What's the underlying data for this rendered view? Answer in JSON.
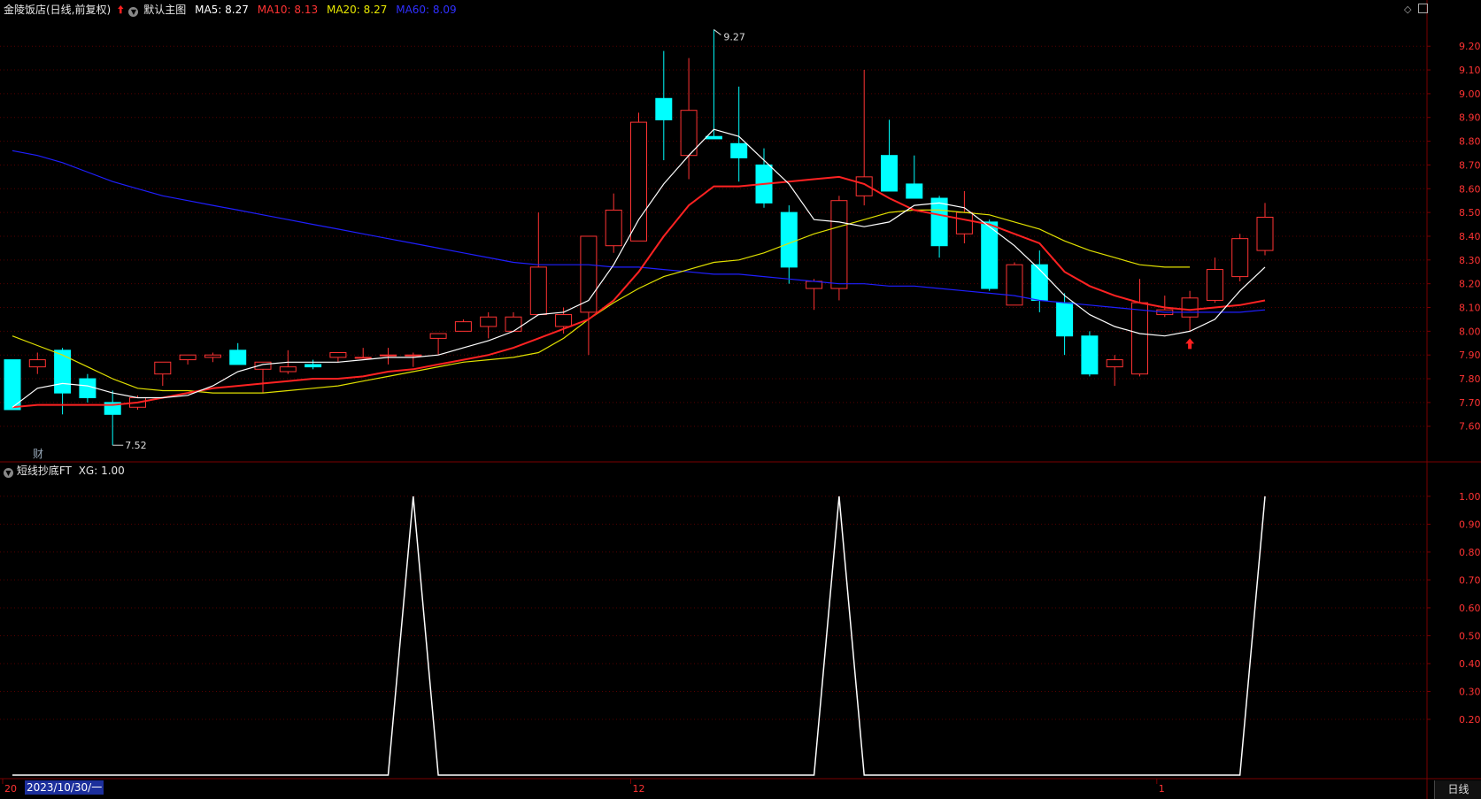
{
  "header": {
    "stock_name": "金陵饭店(日线,前复权)",
    "template_label": "默认主图",
    "ma": [
      {
        "label": "MA5:",
        "value": "8.27",
        "color": "#ffffff"
      },
      {
        "label": "MA10:",
        "value": "8.13",
        "color": "#ff3333"
      },
      {
        "label": "MA20:",
        "value": "8.27",
        "color": "#e8e800"
      },
      {
        "label": "MA60:",
        "value": "8.09",
        "color": "#2a2aff"
      }
    ]
  },
  "sub_header": {
    "indicator_name": "短线抄底FT",
    "xg_label": "XG:",
    "xg_value": "1.00"
  },
  "colors": {
    "up": "#ff3333",
    "down": "#00ffff",
    "grid": "#550000",
    "axis_text": "#ff3333",
    "ma5": "#ffffff",
    "ma10": "#ff2222",
    "ma20": "#e0e000",
    "ma60": "#1f1fff",
    "xg_line": "#ffffff"
  },
  "icons": {
    "up_arrow": "red-up-arrow-icon",
    "toggle": "circle-chevron-icon",
    "fin_marker": "财"
  },
  "price_axis": {
    "min": 7.45,
    "max": 9.32,
    "ticks": [
      "9.20",
      "9.10",
      "9.00",
      "8.90",
      "8.80",
      "8.70",
      "8.60",
      "8.50",
      "8.40",
      "8.30",
      "8.20",
      "8.10",
      "8.00",
      "7.90",
      "7.80",
      "7.70",
      "7.60"
    ]
  },
  "indicator_axis": {
    "min": 0,
    "max": 1.06,
    "ticks": [
      "1.00",
      "0.90",
      "0.80",
      "0.70",
      "0.60",
      "0.50",
      "0.40",
      "0.30",
      "0.20"
    ]
  },
  "annotations": {
    "high": "9.27",
    "low": "7.52",
    "fin_label": "财"
  },
  "x_axis": {
    "labels": [
      "20",
      "12",
      "1"
    ],
    "cursor_date": "2023/10/30/一"
  },
  "period_button": "日线",
  "chart_data": {
    "type": "candlestick",
    "ohlc": [
      [
        7.88,
        7.88,
        7.67,
        7.67
      ],
      [
        7.85,
        7.91,
        7.82,
        7.88
      ],
      [
        7.92,
        7.93,
        7.65,
        7.74
      ],
      [
        7.8,
        7.82,
        7.7,
        7.72
      ],
      [
        7.7,
        7.75,
        7.52,
        7.65
      ],
      [
        7.68,
        7.73,
        7.67,
        7.72
      ],
      [
        7.82,
        7.87,
        7.77,
        7.87
      ],
      [
        7.88,
        7.9,
        7.86,
        7.9
      ],
      [
        7.89,
        7.91,
        7.87,
        7.9
      ],
      [
        7.92,
        7.95,
        7.86,
        7.86
      ],
      [
        7.84,
        7.87,
        7.74,
        7.87
      ],
      [
        7.83,
        7.92,
        7.82,
        7.85
      ],
      [
        7.86,
        7.88,
        7.84,
        7.85
      ],
      [
        7.89,
        7.91,
        7.87,
        7.91
      ],
      [
        7.89,
        7.93,
        7.89,
        7.89
      ],
      [
        7.9,
        7.93,
        7.86,
        7.9
      ],
      [
        7.9,
        7.91,
        7.85,
        7.9
      ],
      [
        7.97,
        7.99,
        7.9,
        7.99
      ],
      [
        8.0,
        8.05,
        8.0,
        8.04
      ],
      [
        8.02,
        8.08,
        7.97,
        8.06
      ],
      [
        8.0,
        8.08,
        8.0,
        8.06
      ],
      [
        8.07,
        8.5,
        8.07,
        8.27
      ],
      [
        8.02,
        8.1,
        7.99,
        8.07
      ],
      [
        8.08,
        8.25,
        7.9,
        8.4
      ],
      [
        8.36,
        8.58,
        8.33,
        8.51
      ],
      [
        8.38,
        8.92,
        8.38,
        8.88
      ],
      [
        8.98,
        9.18,
        8.72,
        8.89
      ],
      [
        8.74,
        9.15,
        8.64,
        8.93
      ],
      [
        8.82,
        9.27,
        8.81,
        8.81
      ],
      [
        8.79,
        9.03,
        8.63,
        8.73
      ],
      [
        8.7,
        8.77,
        8.52,
        8.54
      ],
      [
        8.5,
        8.53,
        8.2,
        8.27
      ],
      [
        8.18,
        8.22,
        8.09,
        8.21
      ],
      [
        8.18,
        8.57,
        8.13,
        8.55
      ],
      [
        8.57,
        9.1,
        8.53,
        8.65
      ],
      [
        8.74,
        8.89,
        8.59,
        8.59
      ],
      [
        8.62,
        8.74,
        8.56,
        8.56
      ],
      [
        8.56,
        8.57,
        8.31,
        8.36
      ],
      [
        8.41,
        8.59,
        8.37,
        8.5
      ],
      [
        8.46,
        8.47,
        8.17,
        8.18
      ],
      [
        8.11,
        8.29,
        8.11,
        8.28
      ],
      [
        8.28,
        8.34,
        8.08,
        8.13
      ],
      [
        8.12,
        8.16,
        7.9,
        7.98
      ],
      [
        7.98,
        8.0,
        7.81,
        7.82
      ],
      [
        7.85,
        7.9,
        7.77,
        7.88
      ],
      [
        7.82,
        8.22,
        7.81,
        8.12
      ],
      [
        8.07,
        8.15,
        8.06,
        8.09
      ],
      [
        8.06,
        8.17,
        8.0,
        8.14
      ],
      [
        8.13,
        8.31,
        8.12,
        8.26
      ],
      [
        8.23,
        8.41,
        8.21,
        8.39
      ],
      [
        8.34,
        8.54,
        8.32,
        8.48
      ]
    ],
    "ma5": [
      7.68,
      7.76,
      7.78,
      7.77,
      7.74,
      7.72,
      7.72,
      7.73,
      7.77,
      7.83,
      7.86,
      7.87,
      7.87,
      7.87,
      7.88,
      7.89,
      7.89,
      7.9,
      7.93,
      7.96,
      8.0,
      8.07,
      8.08,
      8.13,
      8.28,
      8.47,
      8.62,
      8.74,
      8.85,
      8.82,
      8.72,
      8.62,
      8.47,
      8.46,
      8.44,
      8.46,
      8.53,
      8.54,
      8.52,
      8.44,
      8.36,
      8.26,
      8.15,
      8.07,
      8.02,
      7.99,
      7.98,
      8.0,
      8.05,
      8.17,
      8.27
    ],
    "ma10": [
      7.68,
      7.69,
      7.69,
      7.69,
      7.69,
      7.7,
      7.72,
      7.74,
      7.76,
      7.77,
      7.78,
      7.79,
      7.8,
      7.8,
      7.81,
      7.83,
      7.84,
      7.86,
      7.88,
      7.9,
      7.93,
      7.97,
      8.01,
      8.05,
      8.13,
      8.25,
      8.4,
      8.53,
      8.61,
      8.61,
      8.62,
      8.63,
      8.64,
      8.65,
      8.62,
      8.56,
      8.51,
      8.49,
      8.47,
      8.45,
      8.41,
      8.37,
      8.25,
      8.19,
      8.15,
      8.12,
      8.1,
      8.09,
      8.1,
      8.11,
      8.13
    ],
    "ma20": [
      7.98,
      7.94,
      7.9,
      7.85,
      7.8,
      7.76,
      7.75,
      7.75,
      7.74,
      7.74,
      7.74,
      7.75,
      7.76,
      7.77,
      7.79,
      7.81,
      7.83,
      7.85,
      7.87,
      7.88,
      7.89,
      7.91,
      7.97,
      8.05,
      8.12,
      8.18,
      8.23,
      8.26,
      8.29,
      8.3,
      8.33,
      8.37,
      8.41,
      8.44,
      8.47,
      8.5,
      8.51,
      8.51,
      8.5,
      8.49,
      8.46,
      8.43,
      8.38,
      8.34,
      8.31,
      8.28,
      8.27,
      8.27
    ],
    "ma60": [
      8.76,
      8.74,
      8.71,
      8.67,
      8.63,
      8.6,
      8.57,
      8.55,
      8.53,
      8.51,
      8.49,
      8.47,
      8.45,
      8.43,
      8.41,
      8.39,
      8.37,
      8.35,
      8.33,
      8.31,
      8.29,
      8.28,
      8.28,
      8.28,
      8.27,
      8.27,
      8.26,
      8.25,
      8.24,
      8.24,
      8.23,
      8.22,
      8.21,
      8.2,
      8.2,
      8.19,
      8.19,
      8.18,
      8.17,
      8.16,
      8.15,
      8.13,
      8.12,
      8.11,
      8.1,
      8.09,
      8.08,
      8.08,
      8.08,
      8.08,
      8.09
    ],
    "xg": [
      0,
      0,
      0,
      0,
      0,
      0,
      0,
      0,
      0,
      0,
      0,
      0,
      0,
      0,
      0,
      0,
      1,
      0,
      0,
      0,
      0,
      0,
      0,
      0,
      0,
      0,
      0,
      0,
      0,
      0,
      0,
      0,
      0,
      1,
      0,
      0,
      0,
      0,
      0,
      0,
      0,
      0,
      0,
      0,
      0,
      0,
      0,
      0,
      0,
      0,
      1
    ],
    "buy_signal_index": 47
  }
}
